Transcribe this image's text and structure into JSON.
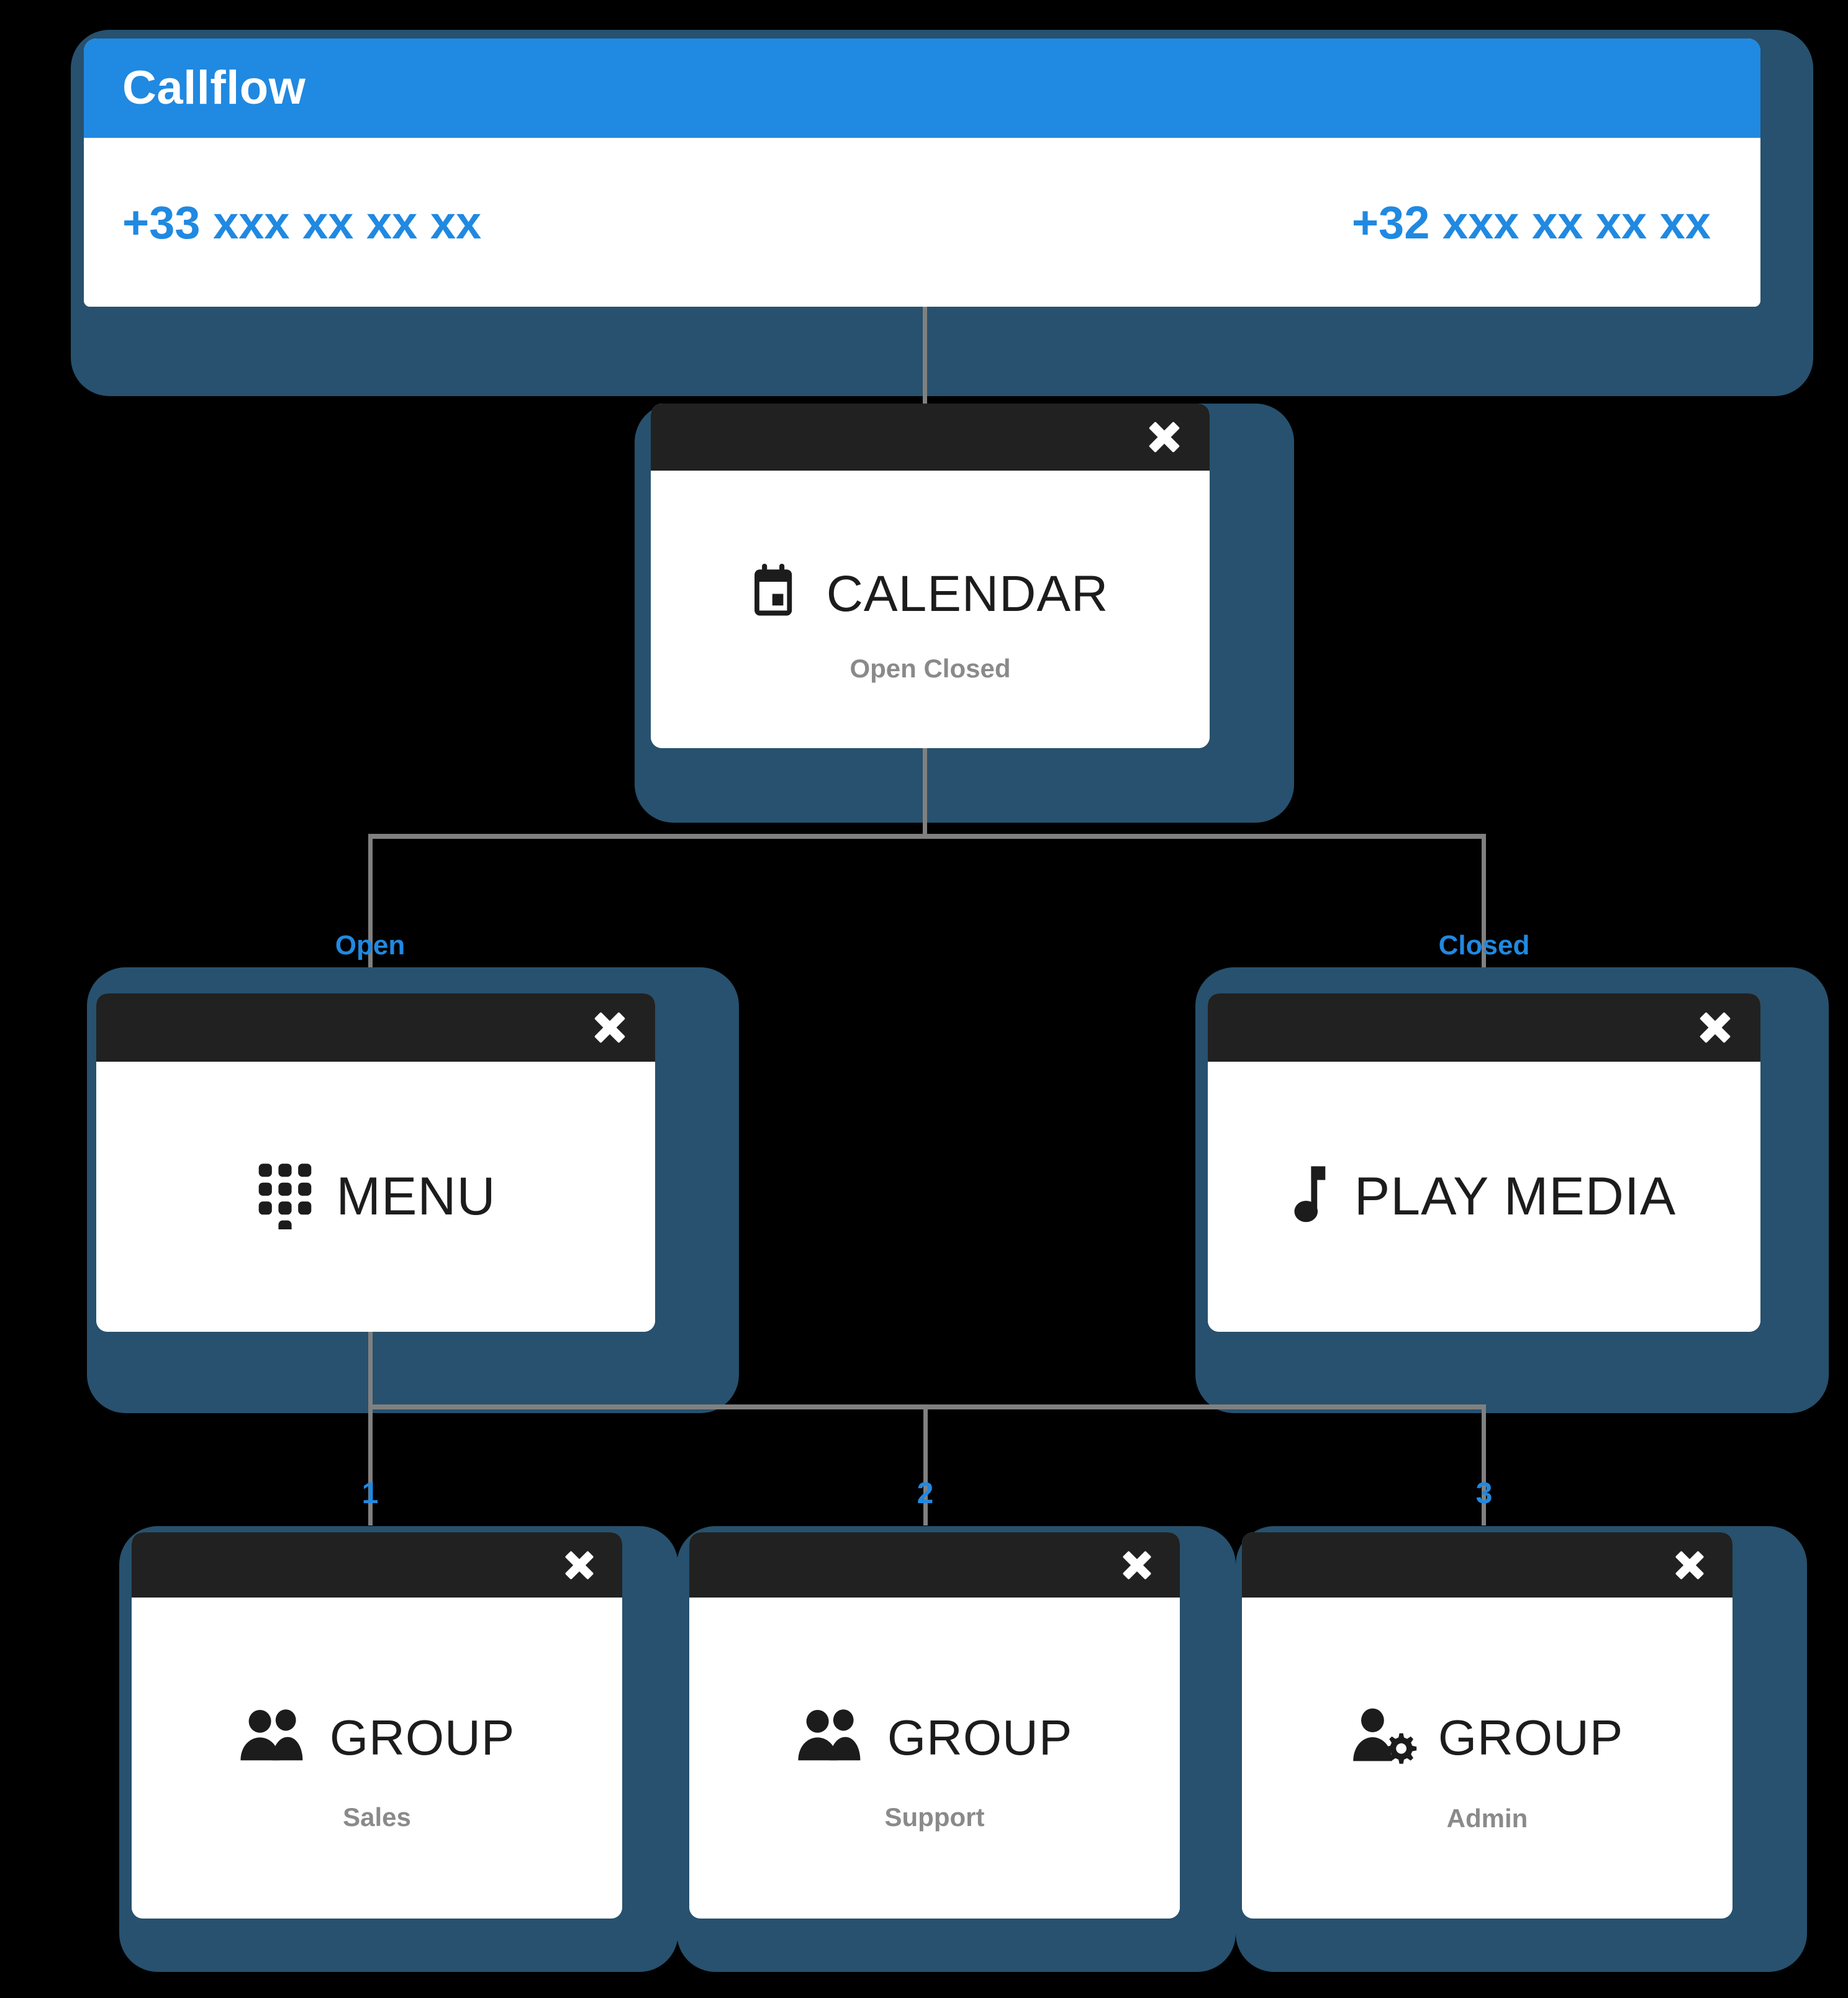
{
  "theme": {
    "background": "#000000",
    "accent_blue": "#2089E1",
    "card_wrapper": "#27516E",
    "node_header": "#212121",
    "node_body": "#ffffff",
    "connector": "#808080",
    "sub_text": "#8a8a8a",
    "label_text": "#1c1c1c"
  },
  "root": {
    "title": "Callflow",
    "numbers": [
      {
        "value": "+33 xxx xx xx xx"
      },
      {
        "value": "+32 xxx xx xx xx"
      }
    ]
  },
  "nodes": {
    "calendar": {
      "label": "CALENDAR",
      "sub": "Open Closed",
      "icon": "calendar-icon",
      "close_label": "×"
    },
    "menu": {
      "label": "MENU",
      "sub": "",
      "icon": "dialpad-icon",
      "close_label": "×"
    },
    "play_media": {
      "label": "PLAY MEDIA",
      "sub": "",
      "icon": "music-note-icon",
      "close_label": "×"
    },
    "group_sales": {
      "label": "GROUP",
      "sub": "Sales",
      "icon": "people-icon",
      "close_label": "×"
    },
    "group_support": {
      "label": "GROUP",
      "sub": "Support",
      "icon": "people-icon",
      "close_label": "×"
    },
    "group_admin": {
      "label": "GROUP",
      "sub": "Admin",
      "icon": "user-gear-icon",
      "close_label": "×"
    }
  },
  "edges": {
    "calendar_open": "Open",
    "calendar_closed": "Closed",
    "menu_option_1": "1",
    "menu_option_2": "2",
    "menu_option_3": "3"
  }
}
